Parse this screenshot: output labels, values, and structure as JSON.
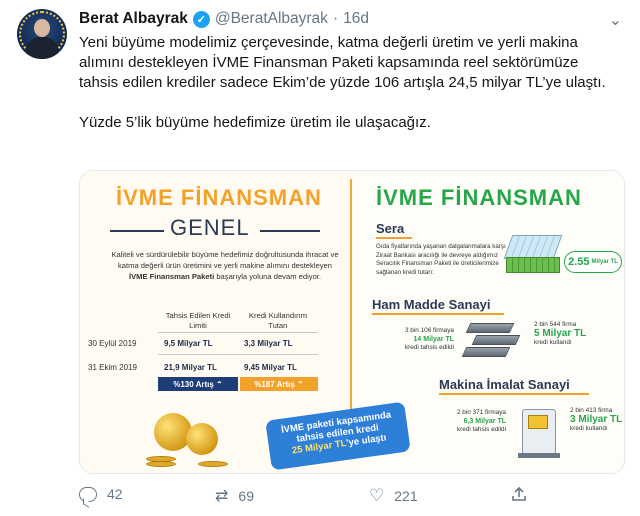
{
  "tweet": {
    "name": "Berat Albayrak",
    "verified_symbol": "✓",
    "handle": "@BeratAlbayrak",
    "separator": "·",
    "date": "16d",
    "more_symbol": "⌄",
    "text_p1": "Yeni büyüme modelimiz çerçevesinde, katma değerli üretim ve yerli makina alımını destekleyen İVME Finansman Paketi kapsamında reel sektörümüze tahsis edilen krediler sadece Ekim’de yüzde 106 artışla 24,5 milyar TL’ye ulaştı.",
    "text_p2": "Yüzde 5’lik büyüme hedefimize üretim ile ulaşacağız."
  },
  "infographic": {
    "left_title": "İVME FİNANSMAN",
    "left_subtitle": "GENEL",
    "left_desc_pre": "Kaliteli ve sürdürülebilir büyüme hedefimiz doğrultusunda ihracat ve katma değerli ürün üretimini ve yerli makine alımını destekleyen ",
    "left_desc_bold": "İVME Finansman Paketi",
    "left_desc_post": " başarıyla yoluna devam ediyor.",
    "col1_header": "Tahsis Edilen Kredi Limiti",
    "col2_header": "Kredi Kullandırım Tutarı",
    "rows": [
      {
        "date": "30 Eylül 2019",
        "limit": "9,5 Milyar TL",
        "used": "3,3 Milyar TL"
      },
      {
        "date": "31 Ekim 2019",
        "limit": "21,9 Milyar TL",
        "used": "9,45 Milyar TL"
      }
    ],
    "increase1": "%130 Artış ⌃",
    "increase2": "%187 Artış ⌃",
    "speech_line1": "İVME paketi kapsamında",
    "speech_line2": "tahsis edilen kredi",
    "speech_highlight": "25 Milyar TL",
    "speech_tail": "'ye ulaştı",
    "right_title": "İVME FİNANSMAN",
    "sera_title": "Sera",
    "sera_desc": "Gıda fiyatlarında yaşanan dalgalanmalara karşı Ziraat Bankası aracılığı ile devreye aldığımız Seracılık Finansman Paketi ile üreticilerimize sağlanan kredi tutarı:",
    "sera_value": "2.55",
    "sera_unit": "Milyar TL",
    "ham_title": "Ham Madde Sanayi",
    "ham_left_1": "3 bin 106 firmaya",
    "ham_left_2": "14 Milyar TL",
    "ham_left_3": "kredi tahsis edildi",
    "ham_right_1": "2 bin 544 firma",
    "ham_right_2": "5 Milyar TL",
    "ham_right_3": "kredi kullandı",
    "mak_title": "Makina İmalat Sanayi",
    "mak_left_1": "2 bin 371 firmaya",
    "mak_left_2": "6,3 Milyar TL",
    "mak_left_3": "kredi tahsis edildi",
    "mak_right_1": "2 bin 413 firma",
    "mak_right_2": "3 Milyar TL",
    "mak_right_3": "kredi kullandı",
    "accent_orange": "#f2a22a",
    "accent_green": "#27a64a",
    "accent_navy": "#1f3e78"
  },
  "actions": {
    "reply_count": "42",
    "retweet_count": "69",
    "like_count": "221",
    "reply_icon": "reply-icon",
    "retweet_icon": "retweet-icon",
    "like_icon": "heart-icon",
    "share_icon": "share-icon",
    "retweet_symbol": "⇄",
    "like_symbol": "♡"
  }
}
